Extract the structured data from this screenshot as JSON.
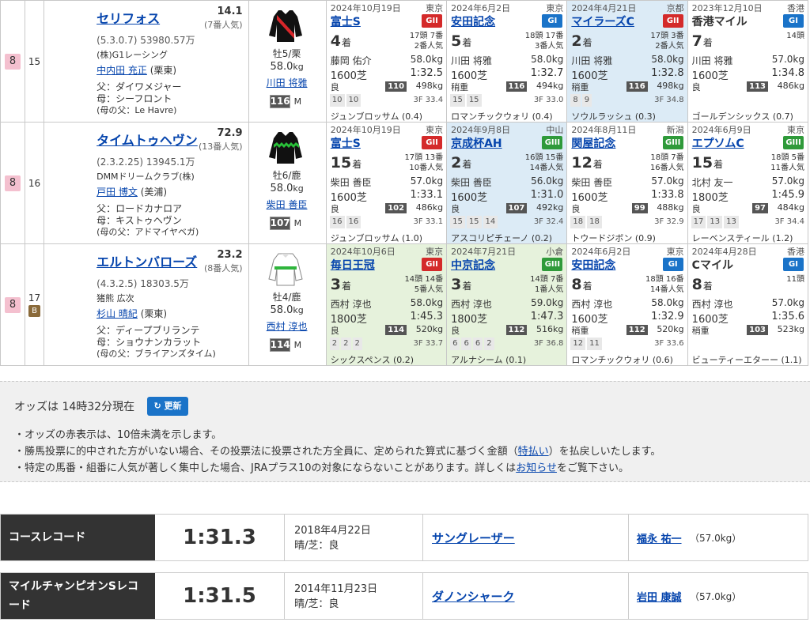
{
  "horses": [
    {
      "waku": "8",
      "umaban": "15",
      "blinker": "",
      "name": "セリフォス",
      "odds": "14.1",
      "pop": "(7番人気)",
      "record": "(5.3.0.7)",
      "prize": "53980.57万",
      "owner": "(株)G1レーシング",
      "trainer": "中内田 充正",
      "trainer_loc": "(栗東)",
      "sire": "父：ダイワメジャー",
      "dam": "母：シーフロント",
      "damsire": "(母の父：Le Havre)",
      "sexage": "牡5/栗",
      "kinryo": "58.0",
      "kg": "kg",
      "jockey": "川田 将雅",
      "rating": "116",
      "rating_cls": "M",
      "silk": "silk-red-black",
      "races": [
        {
          "bg": "w",
          "date": "2024年10月19日",
          "venue": "東京",
          "name": "富士S",
          "link": true,
          "grade": "GII",
          "head1": "17頭 7番",
          "head2": "2番人気",
          "place": "4",
          "jockey": "藤岡 佑介",
          "kinryo": "58.0kg",
          "dist": "1600芝",
          "time": "1:32.5",
          "cond": "良",
          "g": "110",
          "weight": "498kg",
          "pass": [
            "10",
            "10"
          ],
          "f3": "3F 33.4",
          "winner": "ジュンブロッサム (0.4)"
        },
        {
          "bg": "w",
          "date": "2024年6月2日",
          "venue": "東京",
          "name": "安田記念",
          "link": true,
          "grade": "GI",
          "head1": "18頭 17番",
          "head2": "3番人気",
          "place": "5",
          "jockey": "川田 将雅",
          "kinryo": "58.0kg",
          "dist": "1600芝",
          "time": "1:32.7",
          "cond": "稍重",
          "g": "116",
          "weight": "494kg",
          "pass": [
            "15",
            "15"
          ],
          "f3": "3F 33.0",
          "winner": "ロマンチックウォリ (0.4)"
        },
        {
          "bg": "b",
          "date": "2024年4月21日",
          "venue": "京都",
          "name": "マイラーズC",
          "link": true,
          "grade": "GII",
          "head1": "17頭 3番",
          "head2": "2番人気",
          "place": "2",
          "jockey": "川田 将雅",
          "kinryo": "58.0kg",
          "dist": "1600芝",
          "time": "1:32.8",
          "cond": "稍重",
          "g": "116",
          "weight": "498kg",
          "pass": [
            "8",
            "9"
          ],
          "f3": "3F 34.8",
          "winner": "ソウルラッシュ (0.3)"
        },
        {
          "bg": "w",
          "date": "2023年12月10日",
          "venue": "香港",
          "name": "香港マイル",
          "link": false,
          "grade": "GI",
          "head1": "14頭",
          "head2": "",
          "place": "7",
          "jockey": "川田 将雅",
          "kinryo": "57.0kg",
          "dist": "1600芝",
          "time": "1:34.8",
          "cond": "良",
          "g": "113",
          "weight": "486kg",
          "pass": [],
          "f3": "",
          "winner": "ゴールデンシックス (0.7)"
        }
      ]
    },
    {
      "waku": "8",
      "umaban": "16",
      "blinker": "",
      "name": "タイムトゥヘヴン",
      "odds": "72.9",
      "pop": "(13番人気)",
      "record": "(2.3.2.25)",
      "prize": "13945.1万",
      "owner": "DMMドリームクラブ(株)",
      "trainer": "戸田 博文",
      "trainer_loc": "(美浦)",
      "sire": "父：ロードカナロア",
      "dam": "母：キストゥヘヴン",
      "damsire": "(母の父：アドマイヤベガ)",
      "sexage": "牡6/鹿",
      "kinryo": "58.0",
      "kg": "kg",
      "jockey": "柴田 善臣",
      "rating": "107",
      "rating_cls": "M",
      "silk": "silk-black-green",
      "races": [
        {
          "bg": "w",
          "date": "2024年10月19日",
          "venue": "東京",
          "name": "富士S",
          "link": true,
          "grade": "GII",
          "head1": "17頭 13番",
          "head2": "10番人気",
          "place": "15",
          "jockey": "柴田 善臣",
          "kinryo": "57.0kg",
          "dist": "1600芝",
          "time": "1:33.1",
          "cond": "良",
          "g": "102",
          "weight": "486kg",
          "pass": [
            "16",
            "16"
          ],
          "f3": "3F 33.1",
          "winner": "ジュンブロッサム (1.0)"
        },
        {
          "bg": "b",
          "date": "2024年9月8日",
          "venue": "中山",
          "name": "京成杯AH",
          "link": true,
          "grade": "GIII",
          "head1": "16頭 15番",
          "head2": "14番人気",
          "place": "2",
          "jockey": "柴田 善臣",
          "kinryo": "56.0kg",
          "dist": "1600芝",
          "time": "1:31.0",
          "cond": "良",
          "g": "107",
          "weight": "492kg",
          "pass": [
            "15",
            "15",
            "14"
          ],
          "f3": "3F 32.4",
          "winner": "アスコリピチェーノ (0.2)"
        },
        {
          "bg": "w",
          "date": "2024年8月11日",
          "venue": "新潟",
          "name": "関屋記念",
          "link": true,
          "grade": "GIII",
          "head1": "18頭 7番",
          "head2": "16番人気",
          "place": "12",
          "jockey": "柴田 善臣",
          "kinryo": "57.0kg",
          "dist": "1600芝",
          "time": "1:33.8",
          "cond": "良",
          "g": "99",
          "weight": "488kg",
          "pass": [
            "18",
            "18"
          ],
          "f3": "3F 32.9",
          "winner": "トウードジボン (0.9)"
        },
        {
          "bg": "w",
          "date": "2024年6月9日",
          "venue": "東京",
          "name": "エプソムC",
          "link": true,
          "grade": "GIII",
          "head1": "18頭 5番",
          "head2": "11番人気",
          "place": "15",
          "jockey": "北村 友一",
          "kinryo": "57.0kg",
          "dist": "1800芝",
          "time": "1:45.9",
          "cond": "良",
          "g": "97",
          "weight": "484kg",
          "pass": [
            "17",
            "13",
            "13"
          ],
          "f3": "3F 34.4",
          "winner": "レーベンスティール (1.2)"
        }
      ]
    },
    {
      "waku": "8",
      "umaban": "17",
      "blinker": "B",
      "name": "エルトンバローズ",
      "odds": "23.2",
      "pop": "(8番人気)",
      "record": "(4.3.2.5)",
      "prize": "18303.5万",
      "owner": "猪熊 広次",
      "trainer": "杉山 晴紀",
      "trainer_loc": "(栗東)",
      "sire": "父：ディープブリランテ",
      "dam": "母：ショウナンカラット",
      "damsire": "(母の父：ブライアンズタイム)",
      "sexage": "牡4/鹿",
      "kinryo": "58.0",
      "kg": "kg",
      "jockey": "西村 淳也",
      "rating": "114",
      "rating_cls": "M",
      "silk": "silk-white-green",
      "races": [
        {
          "bg": "g",
          "date": "2024年10月6日",
          "venue": "東京",
          "name": "毎日王冠",
          "link": true,
          "grade": "GII",
          "head1": "14頭 14番",
          "head2": "5番人気",
          "place": "3",
          "jockey": "西村 淳也",
          "kinryo": "58.0kg",
          "dist": "1800芝",
          "time": "1:45.3",
          "cond": "良",
          "g": "114",
          "weight": "520kg",
          "pass": [
            "2",
            "2",
            "2"
          ],
          "f3": "3F 33.7",
          "winner": "シックスペンス (0.2)"
        },
        {
          "bg": "g",
          "date": "2024年7月21日",
          "venue": "小倉",
          "name": "中京記念",
          "link": true,
          "grade": "GIII",
          "head1": "14頭 7番",
          "head2": "1番人気",
          "place": "3",
          "jockey": "西村 淳也",
          "kinryo": "59.0kg",
          "dist": "1800芝",
          "time": "1:47.3",
          "cond": "良",
          "g": "112",
          "weight": "516kg",
          "pass": [
            "6",
            "6",
            "6",
            "2"
          ],
          "f3": "3F 36.8",
          "winner": "アルナシーム (0.1)"
        },
        {
          "bg": "w",
          "date": "2024年6月2日",
          "venue": "東京",
          "name": "安田記念",
          "link": true,
          "grade": "GI",
          "head1": "18頭 16番",
          "head2": "14番人気",
          "place": "8",
          "jockey": "西村 淳也",
          "kinryo": "58.0kg",
          "dist": "1600芝",
          "time": "1:32.9",
          "cond": "稍重",
          "g": "112",
          "weight": "520kg",
          "pass": [
            "12",
            "11"
          ],
          "f3": "3F 33.6",
          "winner": "ロマンチックウォリ (0.6)"
        },
        {
          "bg": "w",
          "date": "2024年4月28日",
          "venue": "香港",
          "name": "Cマイル",
          "link": false,
          "grade": "GI",
          "head1": "11頭",
          "head2": "",
          "place": "8",
          "jockey": "西村 淳也",
          "kinryo": "57.0kg",
          "dist": "1600芝",
          "time": "1:35.6",
          "cond": "稍重",
          "g": "103",
          "weight": "523kg",
          "pass": [],
          "f3": "",
          "winner": "ビューティーエターー (1.1)"
        }
      ]
    }
  ],
  "odds_info": {
    "time_text": "オッズは 14時32分現在",
    "refresh": "更新",
    "note1": "・オッズの赤表示は、10倍未満を示します。",
    "note2a": "・勝馬投票に的中された方がいない場合、その投票法に投票された方全員に、定められた算式に基づく金額（",
    "note2link": "特払い",
    "note2b": "）を払戻しいたします。",
    "note3a": "・特定の馬番・組番に人気が著しく集中した場合、JRAプラス10の対象にならないことがあります。詳しくは",
    "note3link": "お知らせ",
    "note3b": "をご覧下さい。"
  },
  "records": [
    {
      "label": "コースレコード",
      "time": "1:31.3",
      "date": "2018年4月22日",
      "cond": "晴/芝：良",
      "horse": "サングレーザー",
      "jockey": "福永 祐一",
      "kg": "（57.0kg）"
    },
    {
      "label": "マイルチャンピオンSレコード",
      "time": "1:31.5",
      "date": "2014年11月23日",
      "cond": "晴/芝：良",
      "horse": "ダノンシャーク",
      "jockey": "岩田 康誠",
      "kg": "（57.0kg）"
    }
  ],
  "colors": {
    "GI": "#1a73c8",
    "GII": "#d42a2a",
    "GIII": "#2f9a3a",
    "waku8": "#f4c0cf",
    "green_bg": "#e6f2dc",
    "blue_bg": "#dcebf6"
  }
}
